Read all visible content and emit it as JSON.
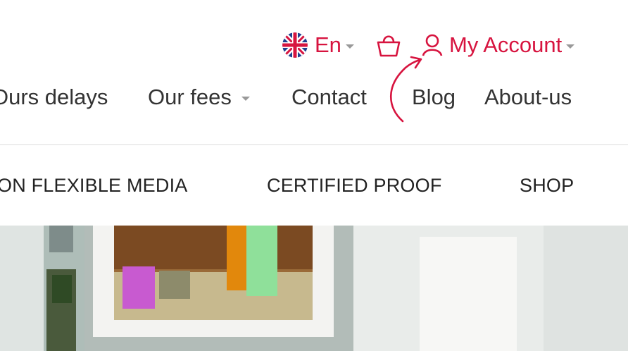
{
  "topbar": {
    "language": {
      "label": "En",
      "flag_icon": "uk-flag-icon"
    },
    "cart": {
      "icon": "shopping-bag-icon"
    },
    "account": {
      "label": "My Account",
      "icon": "user-icon"
    }
  },
  "main_nav": {
    "items": [
      {
        "label": "Ours delays"
      },
      {
        "label": "Our fees"
      },
      {
        "label": "Contact"
      },
      {
        "label": "Blog"
      },
      {
        "label": "About-us"
      }
    ]
  },
  "category_nav": {
    "items": [
      {
        "label": "ON FLEXIBLE MEDIA"
      },
      {
        "label": "CERTIFIED PROOF"
      },
      {
        "label": "SHOP"
      }
    ]
  },
  "colors": {
    "accent": "#d7143f",
    "text": "#333333",
    "divider": "#dcdcdc"
  }
}
